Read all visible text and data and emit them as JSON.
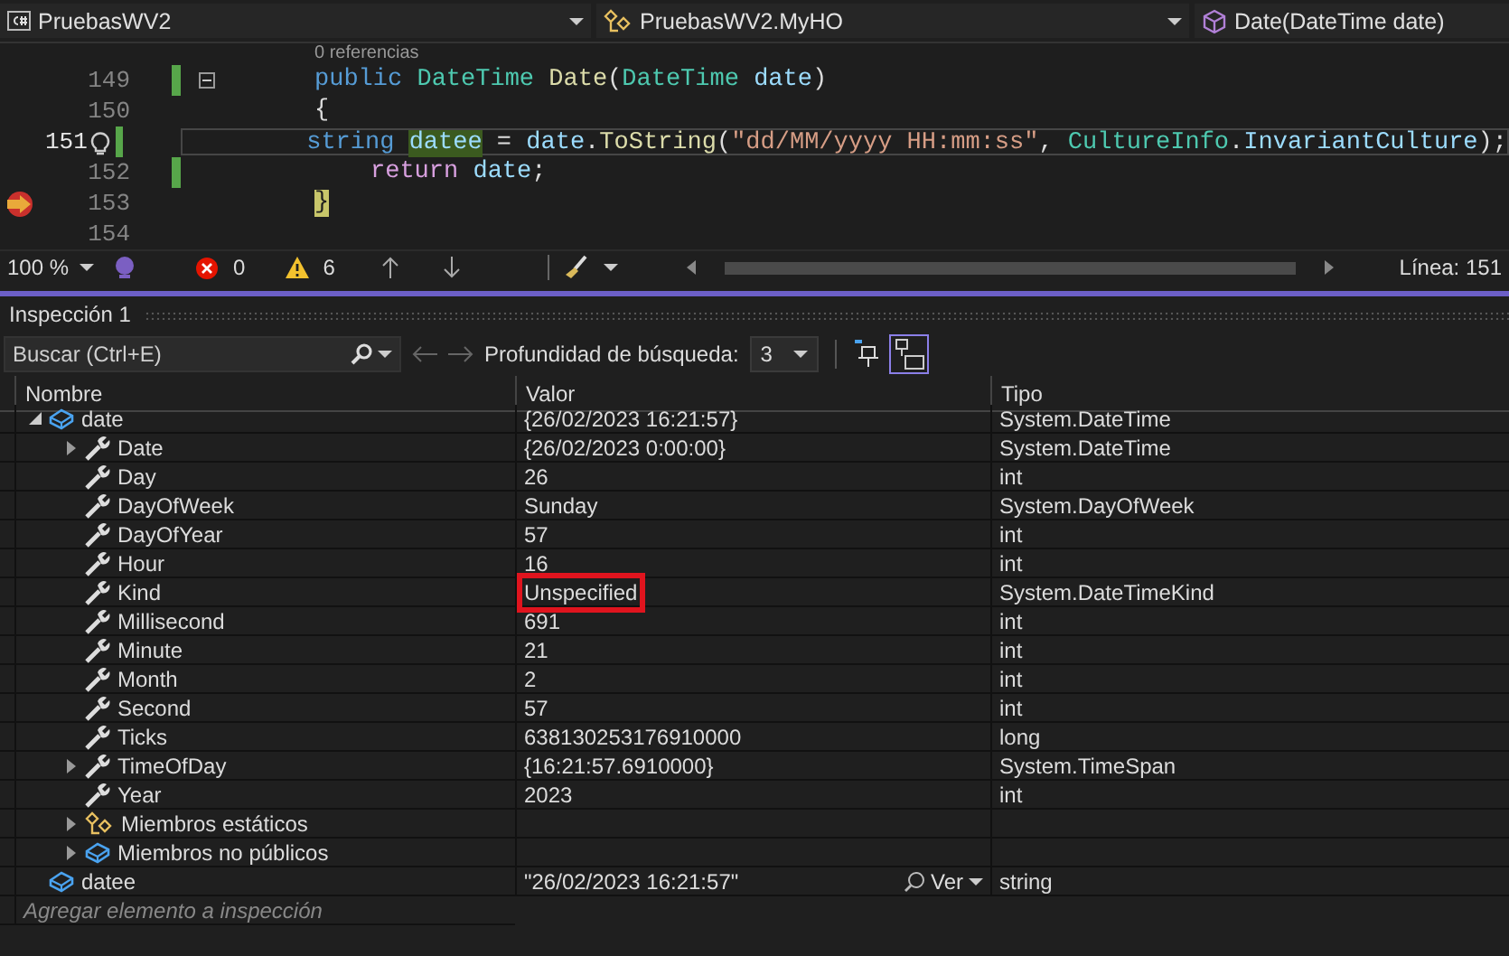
{
  "navbar": {
    "project": "PruebasWV2",
    "type": "PruebasWV2.MyHO",
    "member": "Date(DateTime date)"
  },
  "editor": {
    "codelens": "0 referencias",
    "lines": [
      {
        "number": "149",
        "kind": "outer",
        "changed": true,
        "collapsible": true,
        "current": false,
        "next_statement": false,
        "tokens": [
          {
            "text": "public ",
            "kind": "keyword"
          },
          {
            "text": "DateTime ",
            "kind": "type"
          },
          {
            "text": "Date",
            "kind": "method"
          },
          {
            "text": "(",
            "kind": "plain"
          },
          {
            "text": "DateTime ",
            "kind": "type"
          },
          {
            "text": "date",
            "kind": "ident"
          },
          {
            "text": ")",
            "kind": "plain"
          }
        ]
      },
      {
        "number": "150",
        "kind": "outer",
        "changed": false,
        "collapsible": false,
        "current": false,
        "next_statement": false,
        "tokens": [
          {
            "text": "{",
            "kind": "plain"
          }
        ]
      },
      {
        "number": "151",
        "kind": "inner",
        "changed": true,
        "collapsible": false,
        "current": true,
        "next_statement": false,
        "tokens": [
          {
            "text": "string ",
            "kind": "keyword"
          },
          {
            "text": "datee",
            "kind": "ident",
            "highlighted": true
          },
          {
            "text": " = ",
            "kind": "plain"
          },
          {
            "text": "date",
            "kind": "ident"
          },
          {
            "text": ".",
            "kind": "plain"
          },
          {
            "text": "ToString",
            "kind": "method"
          },
          {
            "text": "(",
            "kind": "plain"
          },
          {
            "text": "\"dd/MM/yyyy HH:mm:ss\"",
            "kind": "string"
          },
          {
            "text": ", ",
            "kind": "plain"
          },
          {
            "text": "CultureInfo",
            "kind": "type"
          },
          {
            "text": ".",
            "kind": "plain"
          },
          {
            "text": "InvariantCulture",
            "kind": "ident"
          },
          {
            "text": ");",
            "kind": "plain"
          }
        ]
      },
      {
        "number": "152",
        "kind": "inner",
        "changed": true,
        "collapsible": false,
        "current": false,
        "next_statement": false,
        "tokens": [
          {
            "text": "return ",
            "kind": "control"
          },
          {
            "text": "date",
            "kind": "ident"
          },
          {
            "text": ";",
            "kind": "plain"
          }
        ]
      },
      {
        "number": "153",
        "kind": "outer",
        "changed": false,
        "collapsible": false,
        "current": false,
        "next_statement": true,
        "tokens": [
          {
            "text": "}",
            "kind": "plain"
          }
        ]
      },
      {
        "number": "154",
        "kind": "outer",
        "changed": false,
        "collapsible": false,
        "current": false,
        "next_statement": false
      }
    ],
    "status": {
      "zoom": "100 %",
      "errors": "0",
      "warnings": "6",
      "position": "Línea: 151"
    }
  },
  "watch": {
    "title": "Inspección 1",
    "search": {
      "placeholder": "Buscar (Ctrl+E)"
    },
    "depth_label": "Profundidad de búsqueda:",
    "depth": "3",
    "columns": [
      "Nombre",
      "Valor",
      "Tipo"
    ],
    "rows": [
      {
        "name": "date",
        "kind": "object",
        "expanded": true,
        "value": "{26/02/2023 16:21:57}",
        "type": "System.DateTime",
        "children": [
          {
            "name": "Date",
            "kind": "property",
            "expanded": false,
            "value": "{26/02/2023 0:00:00}",
            "type": "System.DateTime"
          },
          {
            "name": "Day",
            "kind": "property",
            "value": "26",
            "type": "int"
          },
          {
            "name": "DayOfWeek",
            "kind": "property",
            "value": "Sunday",
            "type": "System.DayOfWeek"
          },
          {
            "name": "DayOfYear",
            "kind": "property",
            "value": "57",
            "type": "int"
          },
          {
            "name": "Hour",
            "kind": "property",
            "value": "16",
            "type": "int"
          },
          {
            "name": "Kind",
            "kind": "property",
            "value": "Unspecified",
            "type": "System.DateTimeKind",
            "highlighted": true
          },
          {
            "name": "Millisecond",
            "kind": "property",
            "value": "691",
            "type": "int"
          },
          {
            "name": "Minute",
            "kind": "property",
            "value": "21",
            "type": "int"
          },
          {
            "name": "Month",
            "kind": "property",
            "value": "2",
            "type": "int"
          },
          {
            "name": "Second",
            "kind": "property",
            "value": "57",
            "type": "int"
          },
          {
            "name": "Ticks",
            "kind": "property",
            "value": "638130253176910000",
            "type": "long"
          },
          {
            "name": "TimeOfDay",
            "kind": "property",
            "expanded": false,
            "value": "{16:21:57.6910000}",
            "type": "System.TimeSpan"
          },
          {
            "name": "Year",
            "kind": "property",
            "value": "2023",
            "type": "int"
          },
          {
            "name": "Miembros estáticos",
            "kind": "static",
            "expanded": false
          },
          {
            "name": "Miembros no públicos",
            "kind": "object",
            "expanded": false
          }
        ]
      },
      {
        "name": "datee",
        "kind": "object",
        "value": "\"26/02/2023 16:21:57\"",
        "visualizer": "Ver",
        "type": "string"
      }
    ],
    "add_row": "Agregar elemento a inspección"
  }
}
